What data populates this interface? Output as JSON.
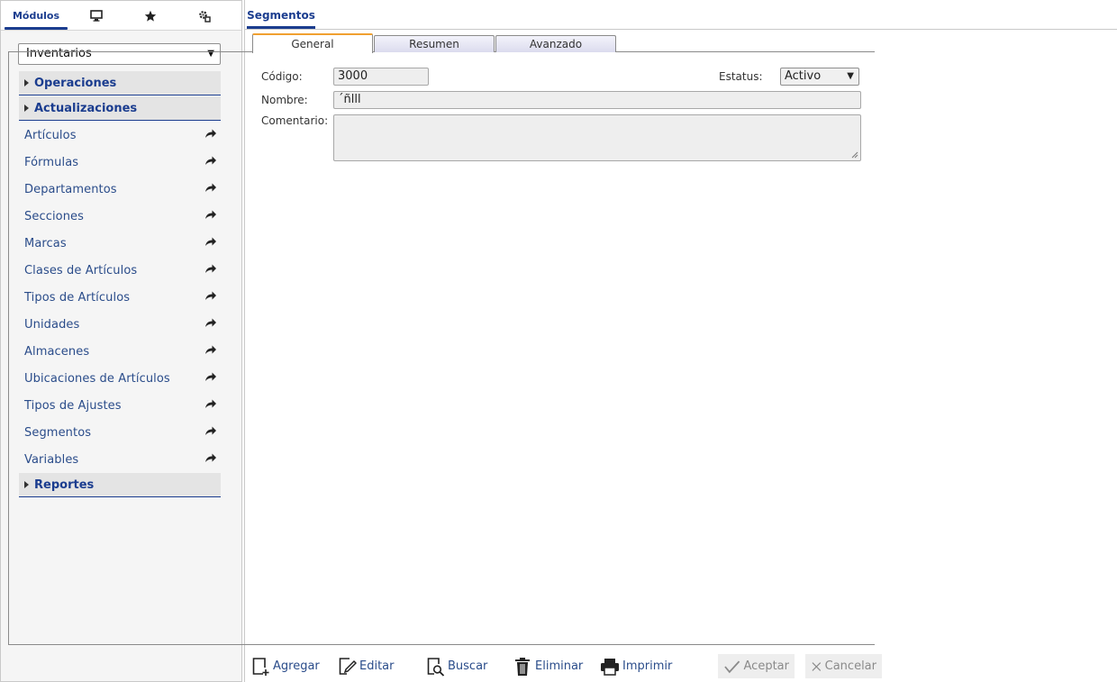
{
  "left_tabs": {
    "modules_label": "Módulos",
    "icons": [
      "monitor-icon",
      "star-icon",
      "settings-icon"
    ]
  },
  "module_select": {
    "value": "Inventarios"
  },
  "sections": [
    {
      "label": "Operaciones"
    },
    {
      "label": "Actualizaciones"
    },
    {
      "label": "Reportes"
    }
  ],
  "menu_items": [
    "Artículos",
    "Fórmulas",
    "Departamentos",
    "Secciones",
    "Marcas",
    "Clases de Artículos",
    "Tipos de Artículos",
    "Unidades",
    "Almacenes",
    "Ubicaciones de Artículos",
    "Tipos de Ajustes",
    "Segmentos",
    "Variables"
  ],
  "document_tab": "Segmentos",
  "form_tabs": [
    "General",
    "Resumen",
    "Avanzado"
  ],
  "form": {
    "codigo_label": "Código:",
    "codigo_value": "3000",
    "nombre_label": "Nombre:",
    "nombre_value": "´ñlll",
    "comentario_label": "Comentario:",
    "comentario_value": "",
    "estatus_label": "Estatus:",
    "estatus_value": "Activo"
  },
  "toolbar": {
    "agregar": "Agregar",
    "editar": "Editar",
    "buscar": "Buscar",
    "eliminar": "Eliminar",
    "imprimir": "Imprimir",
    "aceptar": "Aceptar",
    "cancelar": "Cancelar"
  },
  "colors": {
    "accent": "#1b3d8f",
    "active_tab_border": "#f0a030",
    "link": "#2a4c8a"
  }
}
